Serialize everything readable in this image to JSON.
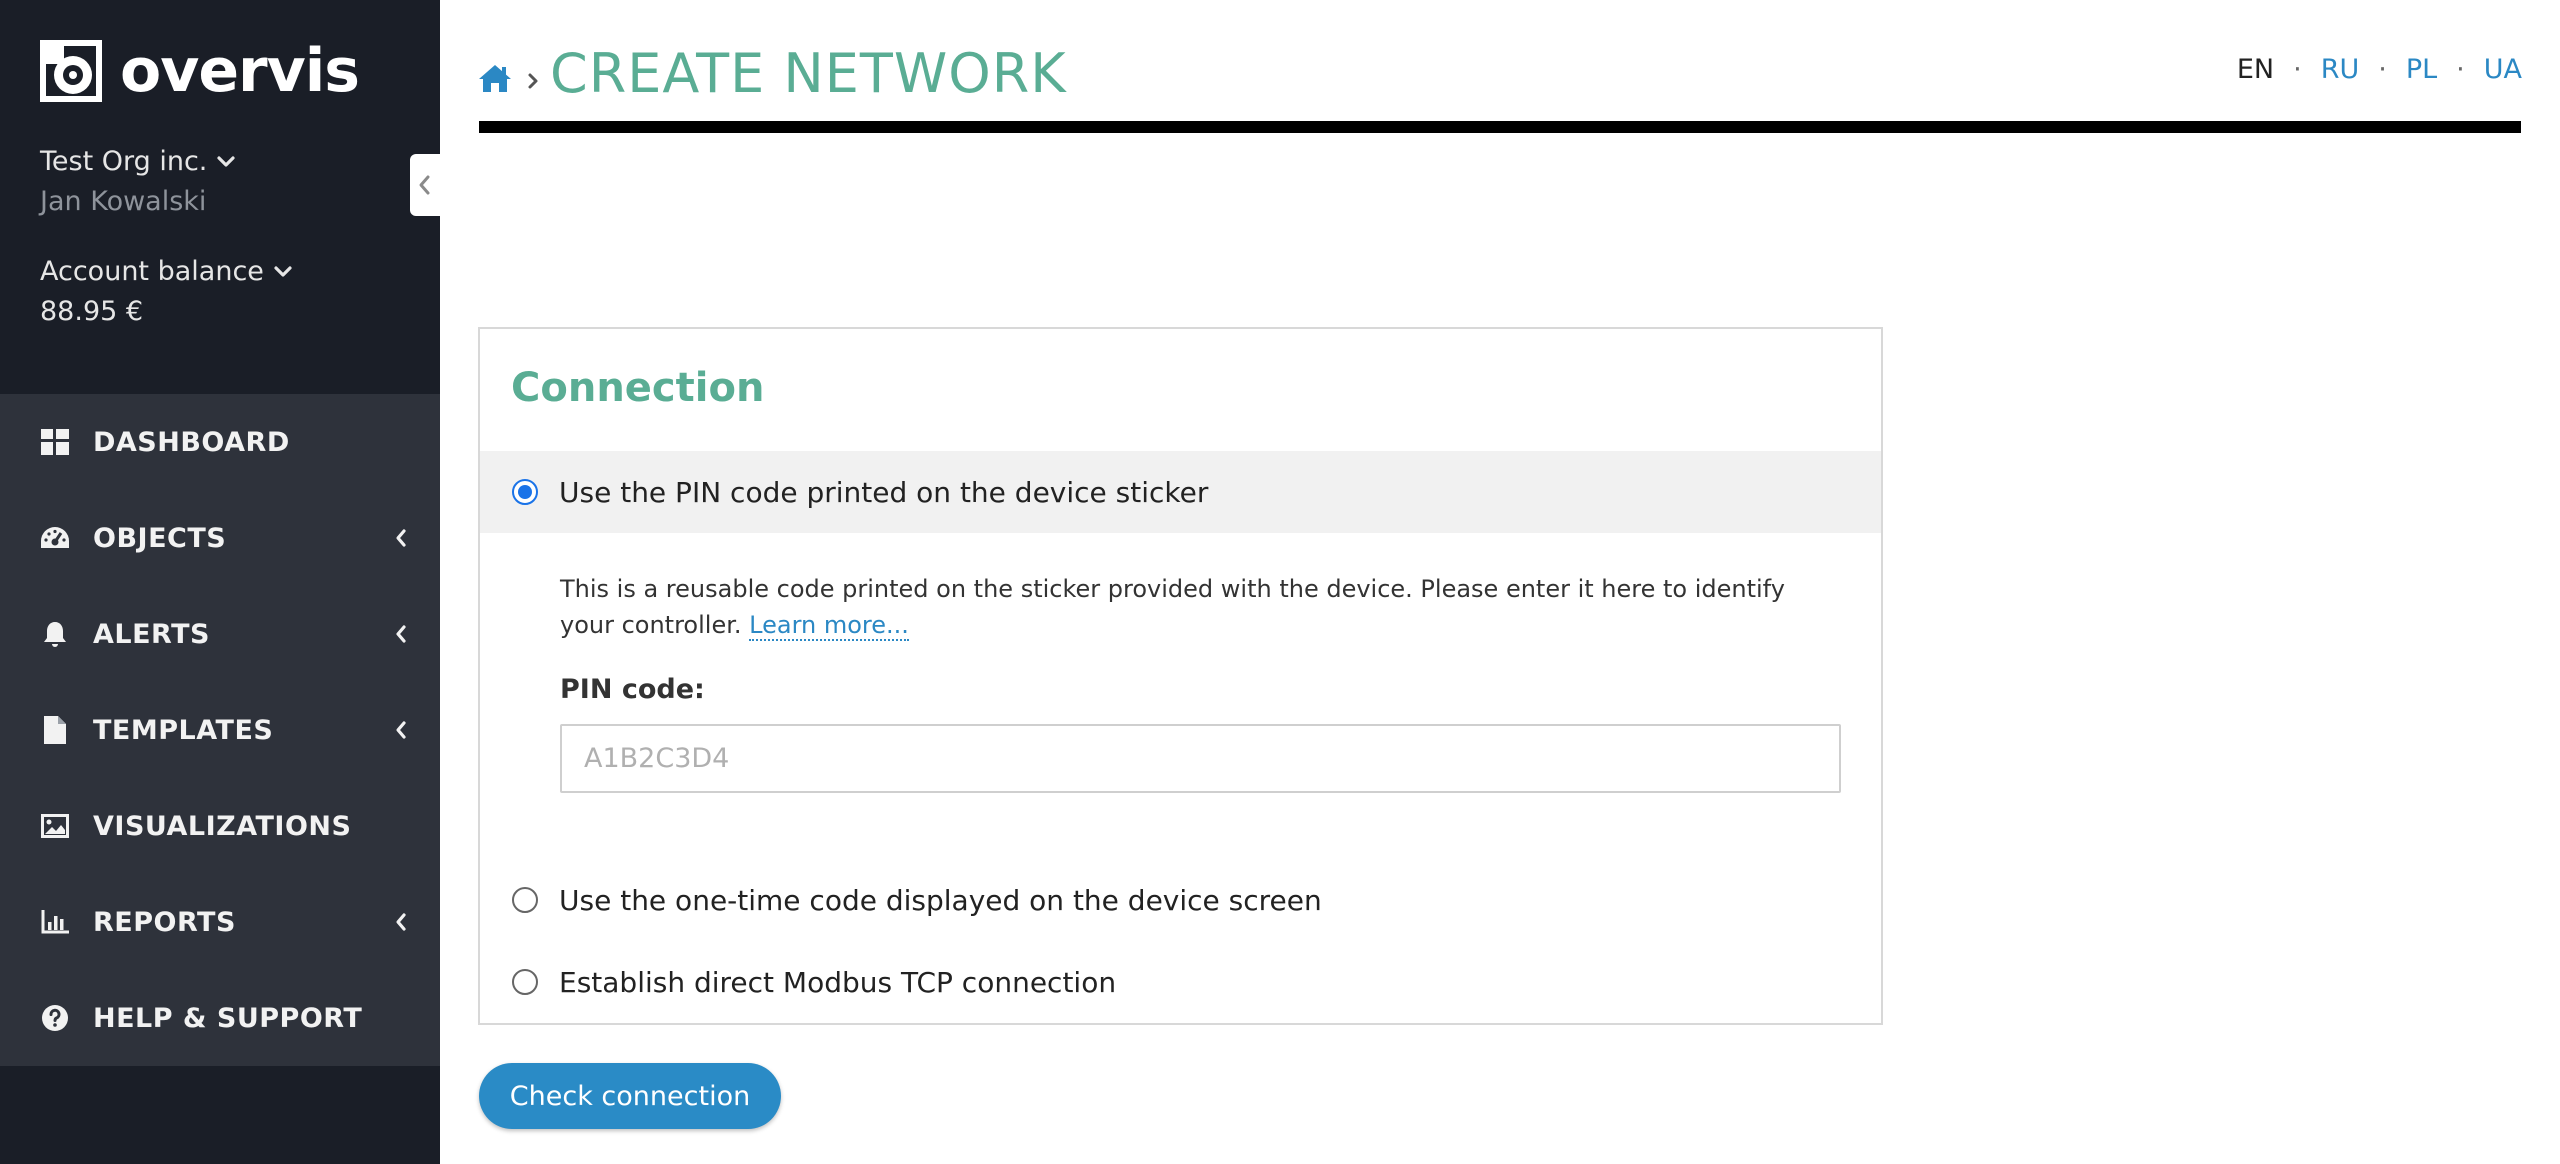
{
  "app": {
    "logo_text": "overvis"
  },
  "account": {
    "org_name": "Test Org inc.",
    "user_name": "Jan Kowalski",
    "balance_label": "Account balance",
    "balance_value": "88.95 €"
  },
  "sidebar": {
    "items": [
      {
        "label": "DASHBOARD",
        "icon": "dashboard-icon",
        "has_submenu": false
      },
      {
        "label": "OBJECTS",
        "icon": "gauge-icon",
        "has_submenu": true
      },
      {
        "label": "ALERTS",
        "icon": "bell-icon",
        "has_submenu": true
      },
      {
        "label": "TEMPLATES",
        "icon": "file-icon",
        "has_submenu": true
      },
      {
        "label": "VISUALIZATIONS",
        "icon": "image-icon",
        "has_submenu": false
      },
      {
        "label": "REPORTS",
        "icon": "bar-chart-icon",
        "has_submenu": true
      },
      {
        "label": "HELP & SUPPORT",
        "icon": "question-circle-icon",
        "has_submenu": false
      }
    ]
  },
  "header": {
    "title": "CREATE NETWORK",
    "languages": {
      "current": "EN",
      "options": [
        "RU",
        "PL",
        "UA"
      ]
    }
  },
  "connection": {
    "title": "Connection",
    "options": [
      "Use the PIN code printed on the device sticker",
      "Use the one-time code displayed on the device screen",
      "Establish direct Modbus TCP connection"
    ],
    "selected_index": 0,
    "description": "This is a reusable code printed on the sticker provided with the device. Please enter it here to identify your controller.",
    "learn_more": "Learn more...",
    "pin_label": "PIN code:",
    "pin_placeholder": "A1B2C3D4",
    "pin_value": ""
  },
  "actions": {
    "check_connection": "Check connection"
  },
  "colors": {
    "accent_green": "#5aad94",
    "link_blue": "#2b88c4",
    "button_blue": "#2a8bc6",
    "sidebar_dark": "#1a1e27",
    "sidebar_nav": "#2e323b"
  }
}
